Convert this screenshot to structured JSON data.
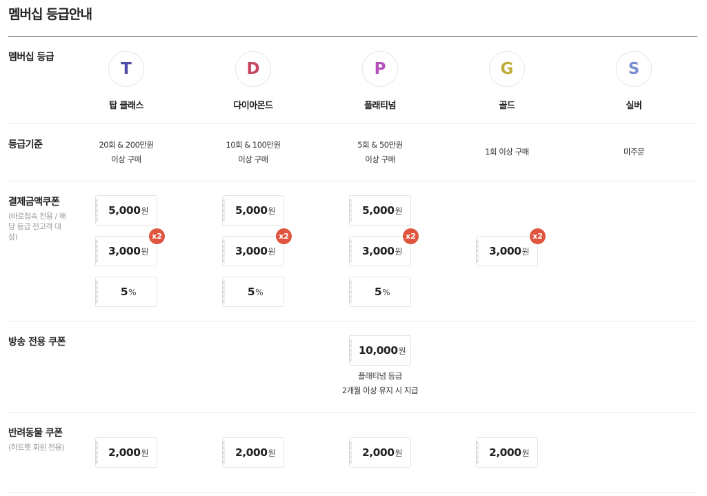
{
  "page_title": "멤버십 등급안내",
  "labels": {
    "grade": "멤버십 등급",
    "criteria": "등급기준",
    "payment_coupon": "결제금액쿠폰",
    "payment_coupon_note": "(바로접속 전용 / 해당 등급 전고객 대상)",
    "shipping_coupon": "방송 전용 쿠폰",
    "pet_coupon": "반려동물 쿠폰",
    "pet_coupon_note": "(하트펫 회원 전용)"
  },
  "grades": [
    {
      "letter": "T",
      "name": "탑 클래스",
      "color": "#4b4aa6",
      "criteria": [
        "20회 & 200만원",
        "이상 구매"
      ]
    },
    {
      "letter": "D",
      "name": "다이아몬드",
      "color": "#c54660",
      "criteria": [
        "10회 & 100만원",
        "이상 구매"
      ]
    },
    {
      "letter": "P",
      "name": "플래티넘",
      "color": "#b54fba",
      "criteria": [
        "5회 & 50만원",
        "이상 구매"
      ]
    },
    {
      "letter": "G",
      "name": "골드",
      "color": "#c1ad3a",
      "criteria": [
        "1회 이상 구매"
      ]
    },
    {
      "letter": "S",
      "name": "실버",
      "color": "#7b8fd0",
      "criteria": [
        "미주문"
      ]
    }
  ],
  "coupon_unit_won": "원",
  "coupon_unit_pct": "%",
  "multiplier_badge": "x2",
  "payment_coupons": [
    [
      "5,000",
      "3,000",
      "5"
    ],
    [
      "5,000",
      "3,000",
      "5"
    ],
    [
      "5,000",
      "3,000",
      "5"
    ],
    [
      "3,000"
    ]
  ],
  "shipping_coupon": {
    "amount": "10,000",
    "note": [
      "플래티넘 등급",
      "2개월 이상 유지 시 지급"
    ]
  },
  "pet_coupons": [
    "2,000",
    "2,000",
    "2,000",
    "2,000"
  ],
  "colors": {
    "badge": "#e0553f",
    "rule": "#555555"
  }
}
